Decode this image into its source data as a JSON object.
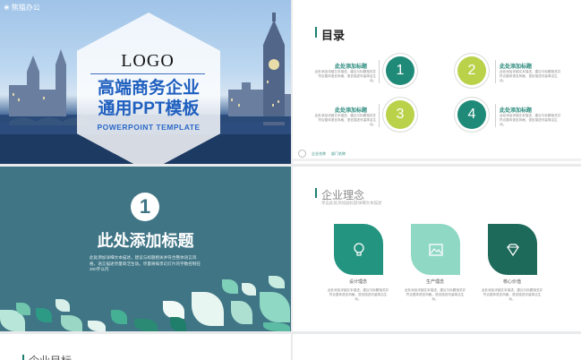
{
  "slide1": {
    "brand": "熊猫办公",
    "logo": "LOGO",
    "title_line1": "高端商务企业",
    "title_line2": "通用PPT模板",
    "subtitle": "POWERPOINT TEMPLATE"
  },
  "slide2": {
    "title": "目录",
    "items": [
      {
        "number": "1",
        "heading": "此处添加标题",
        "text": "此处添加详细文本描述，建议与标题相关并符合整体语言风格，语言描述尽量简洁生动。",
        "color": "#1f8a78"
      },
      {
        "number": "2",
        "heading": "此处添加标题",
        "text": "此处添加详细文本描述，建议与标题相关并符合整体语言风格，语言描述尽量简洁生动。",
        "color": "#b9d24a"
      },
      {
        "number": "3",
        "heading": "此处添加标题",
        "text": "此处添加详细文本描述，建议与标题相关并符合整体语言风格，语言描述尽量简洁生动。",
        "color": "#b9d24a"
      },
      {
        "number": "4",
        "heading": "此处添加标题",
        "text": "此处添加详细文本描述，建议与标题相关并符合整体语言风格，语言描述尽量简洁生动。",
        "color": "#1f8a78"
      }
    ],
    "footer": [
      "企业名称",
      "部门名称"
    ]
  },
  "slide3": {
    "number": "1",
    "heading": "此处添加标题",
    "body": "此处添加详细文本描述，建议与标题相关并符合整体语言风格，语言描述尽量简洁生动。尽量将每页幻灯片的字数控制在200字以内"
  },
  "slide4": {
    "title": "企业理念",
    "subtitle": "单击此处添加副标题详细文本描述",
    "cards": [
      {
        "label": "设计理念",
        "icon": "lightbulb-icon",
        "color": "#239480",
        "text": "此处添加详细文本描述，建议与标题相关并符合整体语言风格，语言描述尽量简洁生动。"
      },
      {
        "label": "生产理念",
        "icon": "picture-icon",
        "color": "#8fd8c4",
        "text": "此处添加详细文本描述，建议与标题相关并符合整体语言风格，语言描述尽量简洁生动。"
      },
      {
        "label": "核心价值",
        "icon": "diamond-icon",
        "color": "#1d6a5a",
        "text": "此处添加详细文本描述，建议与标题相关并符合整体语言风格，语言描述尽量简洁生动。"
      }
    ]
  },
  "slide5": {
    "title": "企业目标"
  },
  "colors": {
    "teal": "#1f8a78",
    "lime": "#b9d24a",
    "slate": "#3f7585",
    "title_blue": "#1f5fbf"
  }
}
